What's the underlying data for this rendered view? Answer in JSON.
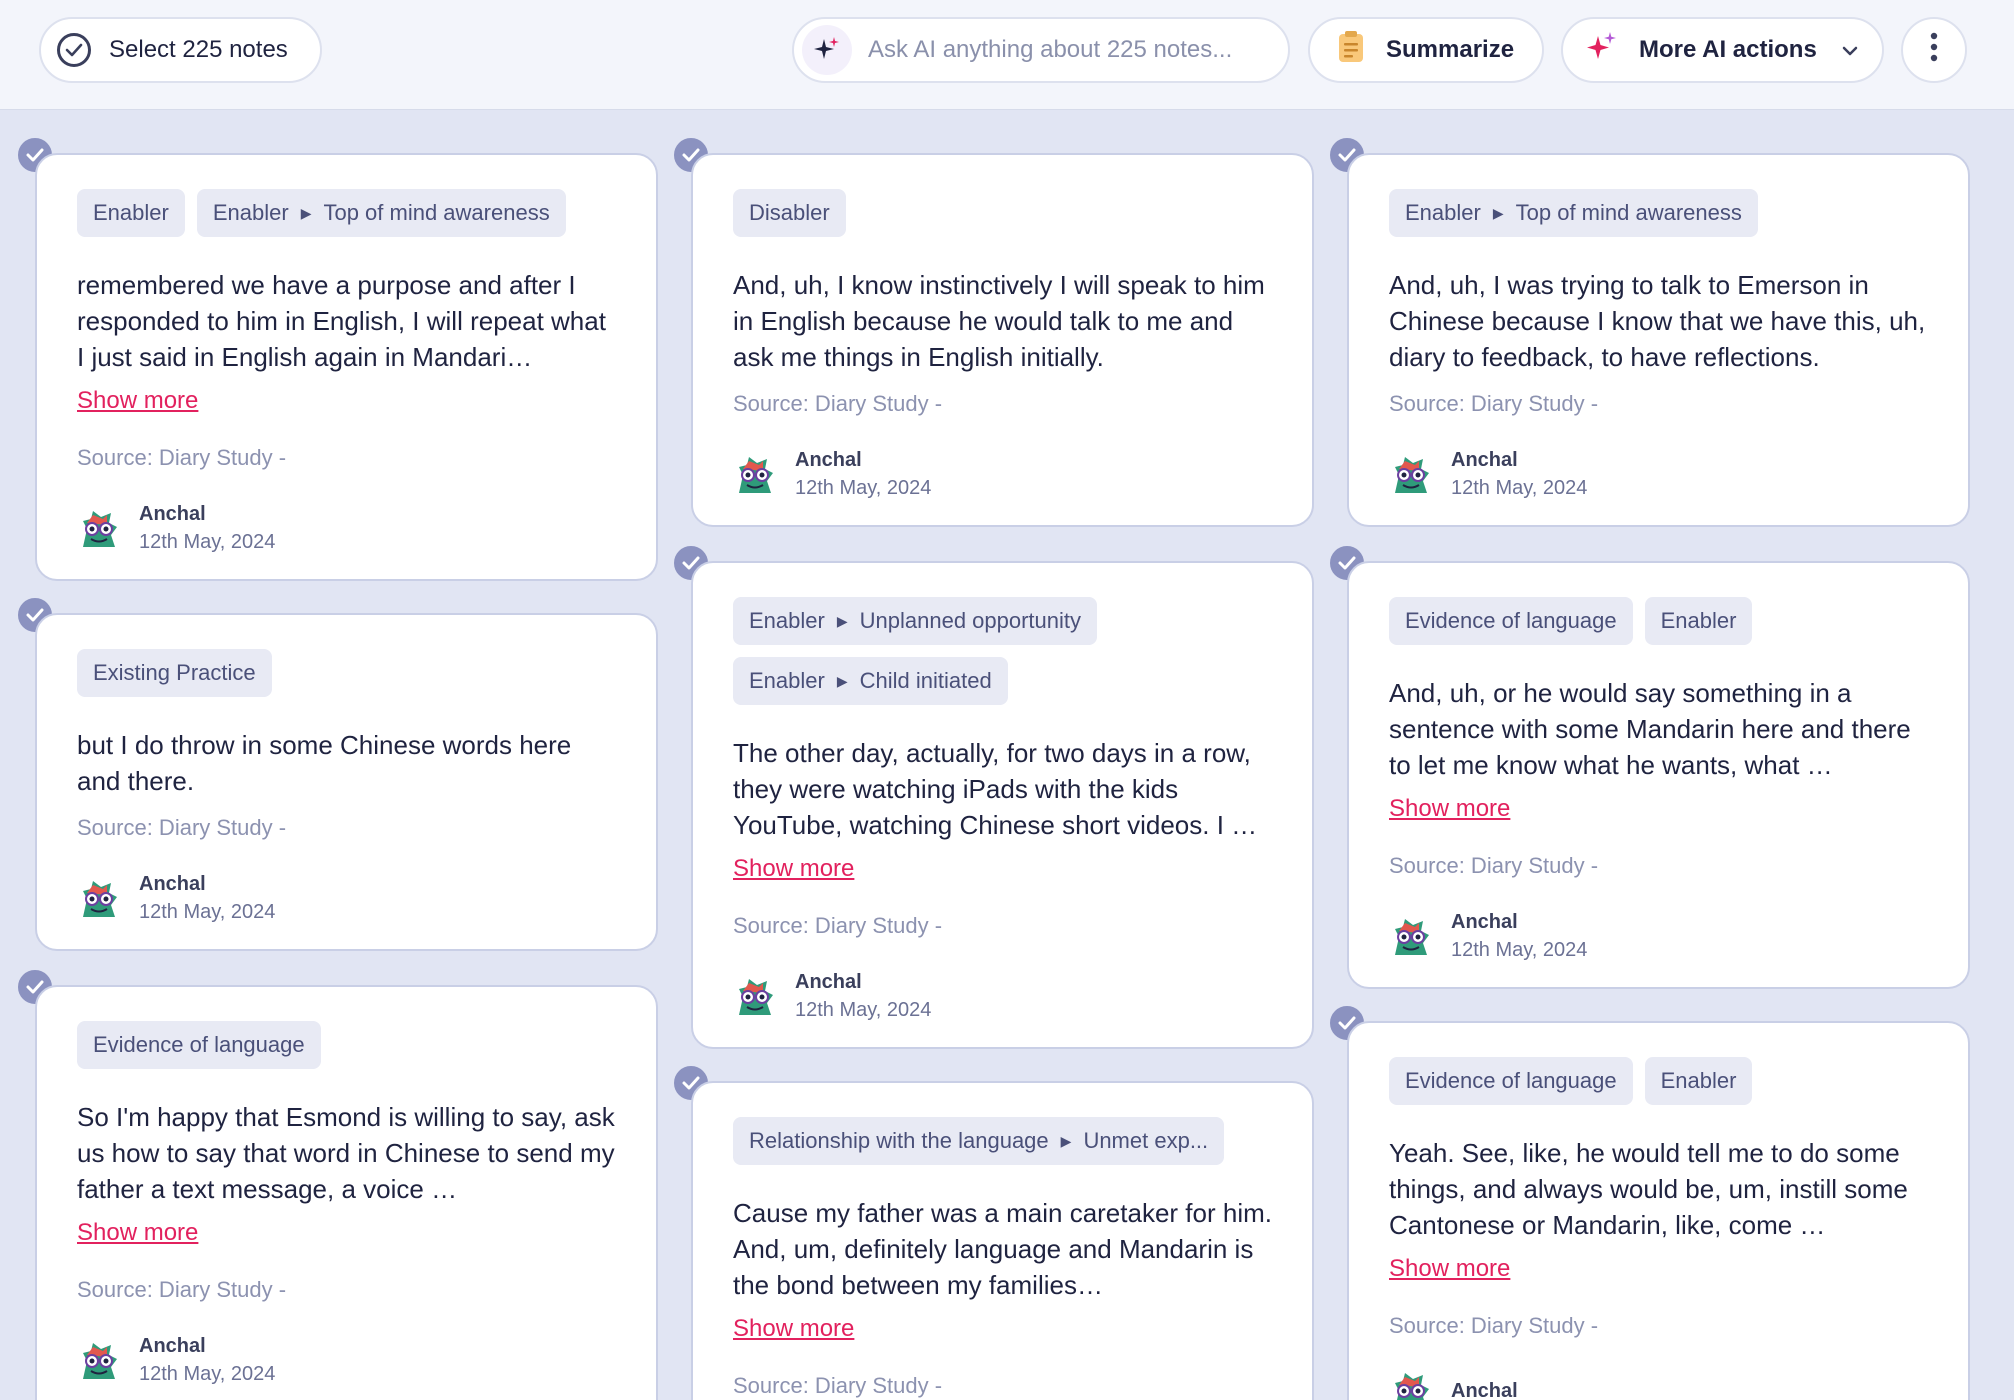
{
  "toolbar": {
    "select_label": "Select 225 notes",
    "ask_placeholder": "Ask AI anything about 225 notes...",
    "summarize_label": "Summarize",
    "more_ai_label": "More AI actions"
  },
  "colors": {
    "accent_pink": "#e2215e",
    "badge": "#8b92c0",
    "tag_bg": "#e8eaf4"
  },
  "cards": [
    {
      "tags": [
        {
          "parts": [
            "Enabler"
          ]
        },
        {
          "parts": [
            "Enabler",
            "Top of mind awareness"
          ]
        }
      ],
      "text": "remembered we have a purpose and after I responded to him in English, I will repeat what I just said in English again in Mandari…",
      "show_more": "Show more",
      "source": "Source: Diary Study -",
      "author": "Anchal",
      "date": "12th May, 2024"
    },
    {
      "tags": [
        {
          "parts": [
            "Existing Practice"
          ]
        }
      ],
      "text": "but I do throw in some Chinese words here and there.",
      "show_more": "",
      "source": "Source: Diary Study -",
      "author": "Anchal",
      "date": "12th May, 2024"
    },
    {
      "tags": [
        {
          "parts": [
            "Evidence of language"
          ]
        }
      ],
      "text": "So I'm happy that Esmond is willing to say, ask us how to say that word in Chinese to send my father a text message,  a voice …",
      "show_more": "Show more",
      "source": "Source: Diary Study -",
      "author": "Anchal",
      "date": "12th May, 2024"
    },
    {
      "tags": [
        {
          "parts": [
            "Disabler"
          ]
        }
      ],
      "text": "And, uh, I know instinctively I will speak to him in English because he would talk to me and ask me things in English initially.",
      "show_more": "",
      "source": "Source: Diary Study -",
      "author": "Anchal",
      "date": "12th May, 2024"
    },
    {
      "tags": [
        {
          "parts": [
            "Enabler",
            "Unplanned opportunity"
          ]
        },
        {
          "parts": [
            "Enabler",
            "Child initiated"
          ]
        }
      ],
      "text": "The other day, actually, for two days in a row, they were watching iPads with the kids YouTube, watching Chinese short videos. I …",
      "show_more": "Show more",
      "source": "Source: Diary Study -",
      "author": "Anchal",
      "date": "12th May, 2024"
    },
    {
      "tags": [
        {
          "parts": [
            "Relationship with the language",
            "Unmet exp..."
          ]
        }
      ],
      "text": "Cause my father was a main caretaker for him.  And, um, definitely language and Mandarin is the bond between my  families…",
      "show_more": "Show more",
      "source": "Source: Diary Study -",
      "author": "",
      "date": ""
    },
    {
      "tags": [
        {
          "parts": [
            "Enabler",
            "Top of mind awareness"
          ]
        }
      ],
      "text": "And, uh, I was trying to talk to Emerson in Chinese because I know that we have this, uh, diary to feedback, to have reflections.",
      "show_more": "",
      "source": "Source: Diary Study -",
      "author": "Anchal",
      "date": "12th May, 2024"
    },
    {
      "tags": [
        {
          "parts": [
            "Evidence of language"
          ]
        },
        {
          "parts": [
            "Enabler"
          ]
        }
      ],
      "text": "And, uh, or he would say something in a sentence with some Mandarin here and there to let me know what he wants, what …",
      "show_more": "Show more",
      "source": "Source: Diary Study -",
      "author": "Anchal",
      "date": "12th May, 2024"
    },
    {
      "tags": [
        {
          "parts": [
            "Evidence of language"
          ]
        },
        {
          "parts": [
            "Enabler"
          ]
        }
      ],
      "text": "Yeah. See, like, he would tell me to do some things, and always would be,  um, instill some Cantonese or Mandarin, like, come …",
      "show_more": "Show more",
      "source": "Source: Diary Study -",
      "author": "Anchal",
      "date": ""
    }
  ]
}
